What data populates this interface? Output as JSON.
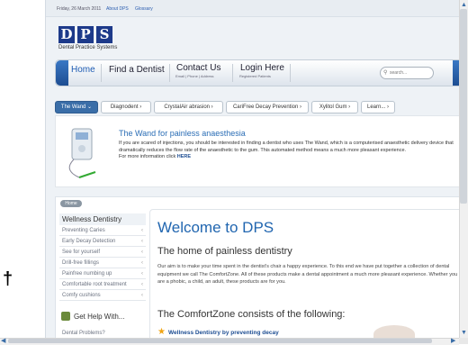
{
  "topbar": {
    "date": "Friday, 26 March 2011",
    "about": "About DPS",
    "glossary": "Glossary"
  },
  "logo": {
    "letters": [
      "D",
      "P",
      "S"
    ],
    "tagline": "Dental Practice Systems",
    "color": "#1d3a8a"
  },
  "nav": {
    "home": "Home",
    "find": "Find a Dentist",
    "contact": "Contact Us",
    "contact_sub": "Email | Phone | Address",
    "login": "Login Here",
    "login_sub": "Registered Patients",
    "search_placeholder": "search..."
  },
  "tabs": [
    "The Wand",
    "Diagnodent",
    "CrystalAir abrasion",
    "CariFree Decay Prevention",
    "Xylitol Gum",
    "Learn..."
  ],
  "promo": {
    "title": "The Wand for painless anaesthesia",
    "body": "If you are scared of injections, you should be interested in finding a dentist who uses The Wand, which is a computerised anaesthetic delivery device that dramatically reduces the flow rate of the anaesthetic to the gum. This automated method means a much more pleasant experience.",
    "more": "For more information click ",
    "here": "HERE"
  },
  "breadcrumb": "Home",
  "sidebar": {
    "heading": "Wellness Dentistry",
    "items": [
      "Preventing Caries",
      "Early Decay Detection",
      "See for yourself",
      "Drill-free fillings",
      "Painfree numbing up",
      "Comfortable root treatment",
      "Comfy cushions"
    ],
    "help": "Get Help With...",
    "problems": "Dental Problems?"
  },
  "content": {
    "h1": "Welcome to DPS",
    "h2a": "The home of painless dentistry",
    "p1": "Our aim is to make your time spent in the dentist's chair a happy experience.  To this end we have put together a collection of dental equipment we call The ComfortZone.  All of these products make a dental appointment a much more pleasant experience.  Whether you are a phobic, a child, an adult, these products are for you.",
    "h2b": "The ComfortZone consists of the following:",
    "bullet1": "Wellness Dentistry by preventing decay"
  },
  "margin_mark": "†",
  "colors": {
    "accent": "#2166b0",
    "nav_cap": "#1d4d92",
    "active_tab": "#3a6ea8",
    "star": "#f0a414"
  }
}
